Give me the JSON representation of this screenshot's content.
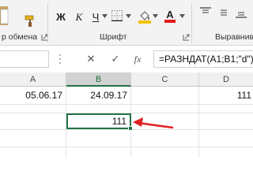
{
  "ribbon": {
    "clipboard_group_label": "р обмена",
    "font_group_label": "Шрифт",
    "alignment_group_label": "Выравнива",
    "format_buttons": {
      "bold": "Ж",
      "italic": "К",
      "underline": "Ч"
    },
    "icons": [
      "paste-icon",
      "format-painter-icon",
      "bold-icon",
      "italic-icon",
      "underline-icon",
      "borders-icon",
      "fill-color-icon",
      "font-color-icon",
      "align-top-icon",
      "align-middle-icon",
      "align-bottom-icon",
      "dialog-launcher-icon"
    ],
    "colors": {
      "fill_accent": "#f2c200",
      "font_color_accent": "#e21b1b"
    }
  },
  "formula_bar": {
    "name_box_value": "",
    "cancel_symbol": "✕",
    "enter_symbol": "✓",
    "fx_label": "fx",
    "formula": "=РАЗНДАТ(A1;B1;\"d\")"
  },
  "sheet": {
    "columns": [
      "A",
      "B",
      "C",
      "D"
    ],
    "selected_column": "B",
    "cells": {
      "A1": "05.06.17",
      "B1": "24.09.17",
      "B3": "111",
      "D1": "111"
    },
    "selected_cell": "B3",
    "selection_color": "#217346",
    "annotation_arrow_color": "#e02020"
  }
}
